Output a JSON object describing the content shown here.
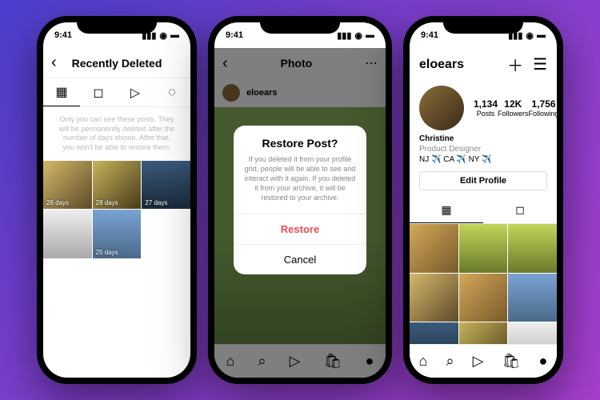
{
  "status": {
    "time": "9:41"
  },
  "phone1": {
    "title": "Recently Deleted",
    "info": "Only you can see these posts. They will be permanently deleted after the number of days shown. After that, you won't be able to restore them.",
    "thumbs": [
      "28 days",
      "28 days",
      "27 days",
      "",
      "25 days",
      ""
    ]
  },
  "phone2": {
    "header_title": "Photo",
    "username": "eloears",
    "modal": {
      "title": "Restore Post?",
      "body": "If you deleted it from your profile grid, people will be able to see and interact with it again. If you deleted it from your archive, it will be restored to your archive.",
      "restore": "Restore",
      "cancel": "Cancel"
    }
  },
  "phone3": {
    "username": "eloears",
    "stats": [
      {
        "num": "1,134",
        "label": "Posts"
      },
      {
        "num": "12K",
        "label": "Followers"
      },
      {
        "num": "1,756",
        "label": "Following"
      }
    ],
    "bio": {
      "name": "Christine",
      "role": "Product Designer",
      "loc": "NJ ✈️ CA ✈️ NY ✈️"
    },
    "edit": "Edit Profile"
  }
}
